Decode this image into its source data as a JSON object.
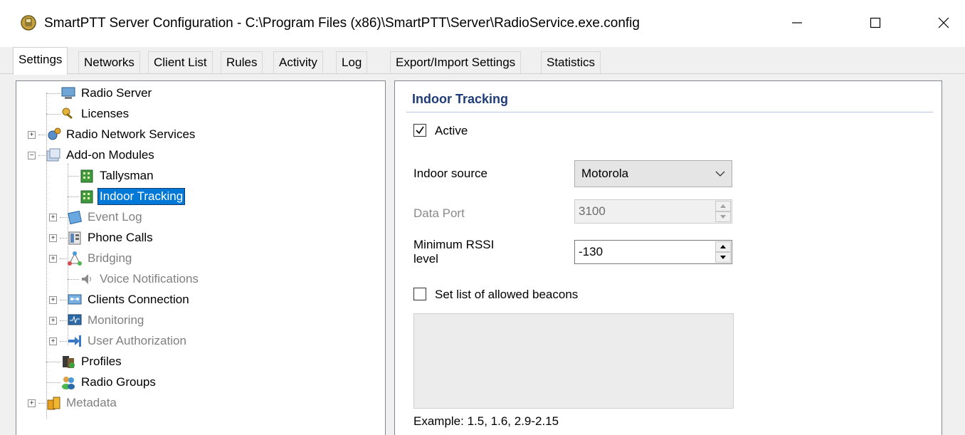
{
  "window": {
    "title": "SmartPTT Server Configuration - C:\\Program Files (x86)\\SmartPTT\\Server\\RadioService.exe.config",
    "controls": {
      "minimize": "minimize",
      "maximize": "maximize",
      "close": "close"
    }
  },
  "tabs": [
    {
      "label": "Settings",
      "active": true
    },
    {
      "label": "Networks"
    },
    {
      "label": "Client List"
    },
    {
      "label": "Rules"
    },
    {
      "label": "Activity"
    },
    {
      "label": "Log"
    },
    {
      "label": "Export/Import Settings"
    },
    {
      "label": "Statistics"
    }
  ],
  "tree": {
    "items": [
      {
        "label": "Radio Server",
        "icon": "server-icon",
        "state": "normal"
      },
      {
        "label": "Licenses",
        "icon": "key-icon",
        "state": "normal"
      },
      {
        "label": "Radio Network Services",
        "icon": "services-icon",
        "state": "normal",
        "expander": "+"
      },
      {
        "label": "Add-on Modules",
        "icon": "modules-icon",
        "state": "normal",
        "expander": "−"
      },
      {
        "label": "Tallysman",
        "icon": "building-icon",
        "state": "normal"
      },
      {
        "label": "Indoor Tracking",
        "icon": "building-icon",
        "state": "selected"
      },
      {
        "label": "Event Log",
        "icon": "event-log-icon",
        "state": "disabled",
        "expander": "+"
      },
      {
        "label": "Phone Calls",
        "icon": "phone-icon",
        "state": "normal",
        "expander": "+"
      },
      {
        "label": "Bridging",
        "icon": "bridging-icon",
        "state": "disabled",
        "expander": "+"
      },
      {
        "label": "Voice Notifications",
        "icon": "speaker-icon",
        "state": "disabled"
      },
      {
        "label": "Clients Connection",
        "icon": "clients-icon",
        "state": "normal",
        "expander": "+"
      },
      {
        "label": "Monitoring",
        "icon": "monitoring-icon",
        "state": "disabled",
        "expander": "+"
      },
      {
        "label": "User Authorization",
        "icon": "authorization-icon",
        "state": "disabled",
        "expander": "+"
      },
      {
        "label": "Profiles",
        "icon": "profiles-icon",
        "state": "normal"
      },
      {
        "label": "Radio Groups",
        "icon": "groups-icon",
        "state": "normal"
      },
      {
        "label": "Metadata",
        "icon": "database-icon",
        "state": "disabled",
        "expander": "+"
      }
    ]
  },
  "panel": {
    "title": "Indoor Tracking",
    "active_label": "Active",
    "active_checked": true,
    "indoor_source_label": "Indoor source",
    "indoor_source_value": "Motorola",
    "data_port_label": "Data Port",
    "data_port_value": "3100",
    "min_rssi_label_line1": "Minimum RSSI",
    "min_rssi_label_line2": "level",
    "min_rssi_value": "-130",
    "beacons_label": "Set list of allowed beacons",
    "beacons_checked": false,
    "example": "Example: 1.5, 1.6, 2.9-2.15"
  },
  "colors": {
    "selection": "#0078d7",
    "section_title": "#1e3c78",
    "disabled_text": "#808080"
  }
}
